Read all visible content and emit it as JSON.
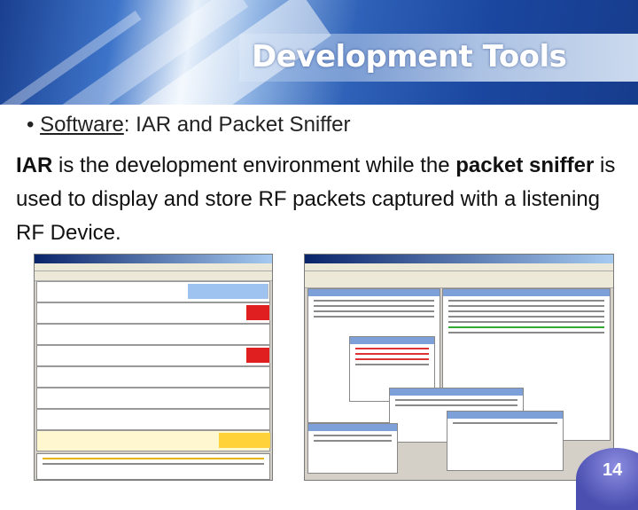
{
  "slide": {
    "title": "Development Tools",
    "bullet": {
      "term": "Software",
      "rest": ": IAR and Packet Sniffer"
    },
    "paragraph": {
      "term1": "IAR",
      "text1": " is the development environment while the ",
      "term2": "packet sniffer",
      "text2": " is used to display and store RF packets captured with a listening RF Device."
    },
    "page_number": "14"
  },
  "images": {
    "left": "packet-sniffer-screenshot",
    "right": "iar-workbench-screenshot"
  },
  "colors": {
    "header_blue": "#1b47a0",
    "text": "#111111",
    "page_badge": "#4b4fb0"
  }
}
